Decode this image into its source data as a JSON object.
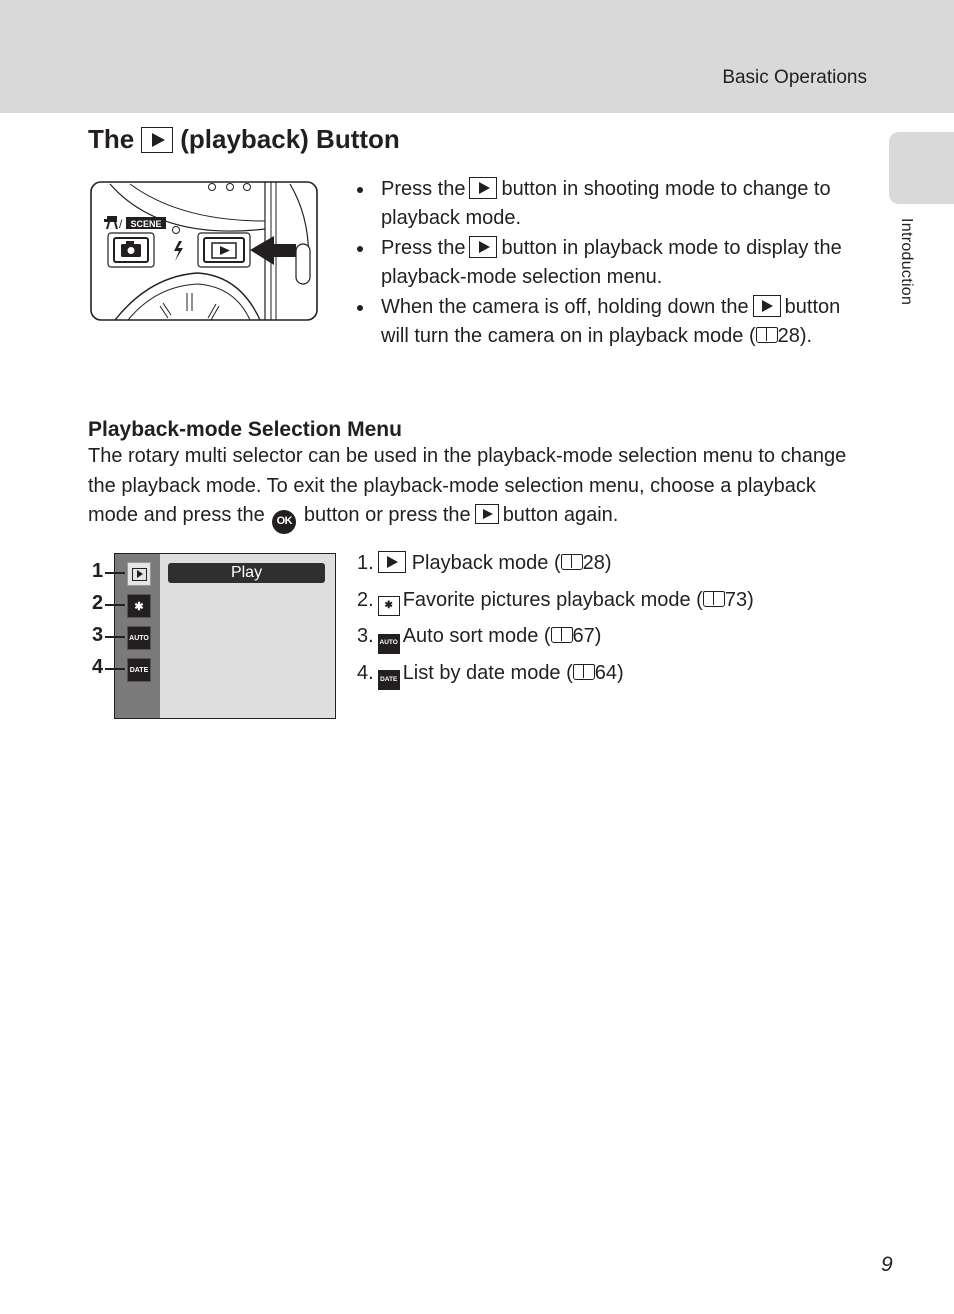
{
  "header": {
    "section_title": "Basic Operations"
  },
  "side_tab": {
    "label": "Introduction"
  },
  "page_title": {
    "before_icon": "The",
    "icon": "playback-button-icon",
    "after_icon": "(playback) Button"
  },
  "camera_illustration": {
    "mode_label": "SCENE"
  },
  "bullets": [
    {
      "parts": [
        "Press the",
        "button in shooting mode to change to playback mode."
      ]
    },
    {
      "parts": [
        "Press the",
        "button in playback mode to display the playback-mode selection menu."
      ]
    },
    {
      "parts": [
        "When the camera is off, holding down the",
        "button will turn the camera on in playback mode (",
        "28)."
      ]
    }
  ],
  "section": {
    "heading": "Playback-mode Selection Menu",
    "paragraph_parts": [
      "The rotary multi selector can be used in the playback-mode selection menu to change the playback mode. To exit the playback-mode selection menu, choose a playback mode and press the",
      "button or press the",
      "button again."
    ],
    "ok_label": "OK"
  },
  "menu_screen": {
    "header_label": "Play",
    "callouts": [
      "1",
      "2",
      "3",
      "4"
    ],
    "icons": [
      {
        "name": "playback-icon",
        "text": ""
      },
      {
        "name": "favorite-pictures-icon",
        "text": "✱"
      },
      {
        "name": "auto-sort-icon",
        "text": "AUTO"
      },
      {
        "name": "list-by-date-icon",
        "text": "DATE"
      }
    ]
  },
  "mode_list": [
    {
      "number": "1.",
      "icon_text": "",
      "label": "Playback mode (",
      "page": "28)"
    },
    {
      "number": "2.",
      "icon_text": "✱",
      "label": "Favorite pictures playback mode (",
      "page": "73)"
    },
    {
      "number": "3.",
      "icon_text": "AUTO",
      "label": "Auto sort mode (",
      "page": "67)"
    },
    {
      "number": "4.",
      "icon_text": "DATE",
      "label": "List by date mode (",
      "page": "64)"
    }
  ],
  "page_number": "9"
}
